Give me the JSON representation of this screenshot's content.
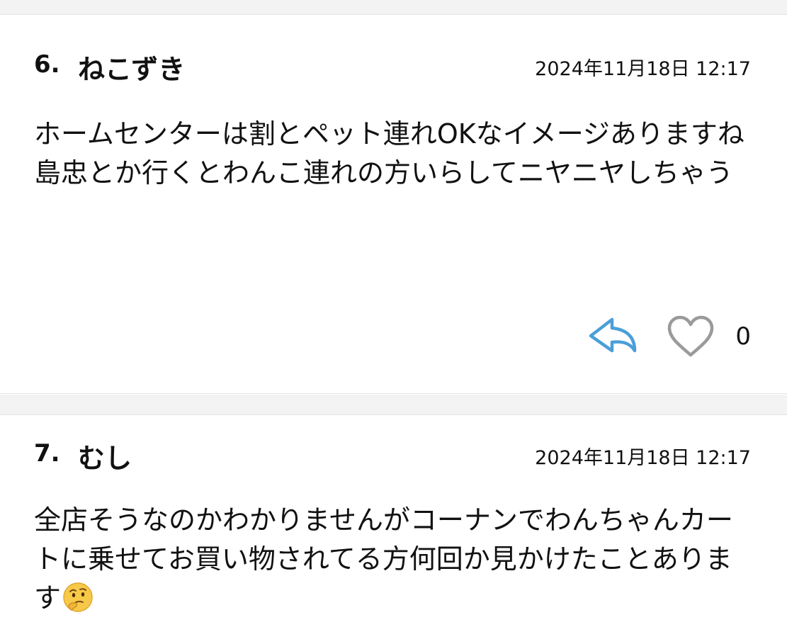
{
  "comments": [
    {
      "number": "6.",
      "name": "ねこずき",
      "date": "2024年11月18日 12:17",
      "body": "ホームセンターは割とペット連れOKなイメージありますね\n島忠とか行くとわんこ連れの方いらしてニヤニヤしちゃう",
      "likes": "0",
      "icons": {
        "reply": "reply-arrow-icon",
        "like": "heart-outline-icon"
      },
      "colors": {
        "reply": "#4a9fd8",
        "heart": "#9a9a9a"
      }
    },
    {
      "number": "7.",
      "name": "むし",
      "date": "2024年11月18日 12:17",
      "body": "全店そうなのかわかりませんがコーナンでわんちゃんカートに乗せてお買い物されてる方何回か見かけたことあります",
      "emoji": "thinking-face-icon"
    }
  ]
}
